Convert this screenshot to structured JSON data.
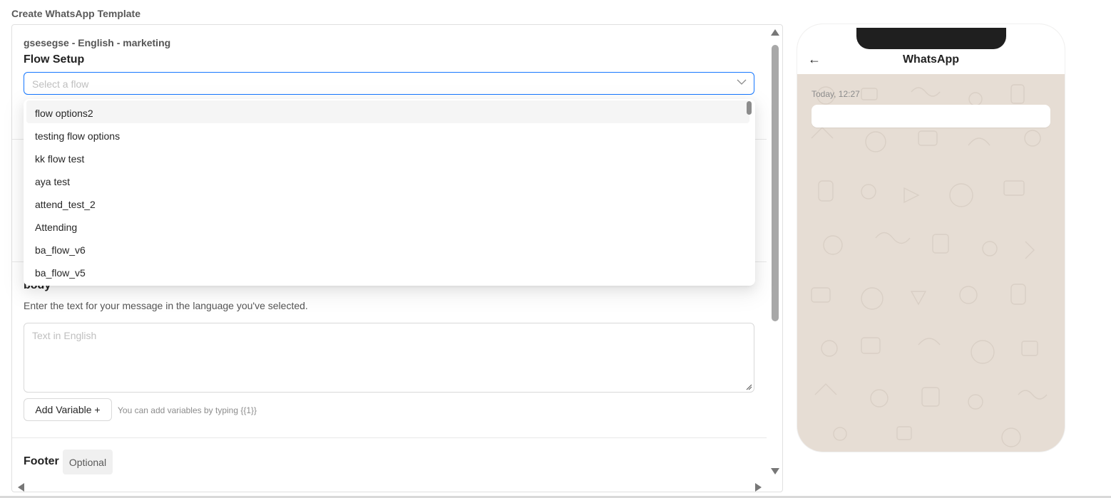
{
  "page": {
    "title": "Create WhatsApp Template"
  },
  "editor": {
    "subtitle": "gsesegse - English - marketing",
    "flow_setup": {
      "title": "Flow Setup",
      "select_placeholder": "Select a flow"
    },
    "dropdown": {
      "options": [
        "flow options2",
        "testing flow options",
        "kk flow test",
        "aya test",
        "attend_test_2",
        "Attending",
        "ba_flow_v6",
        "ba_flow_v5"
      ],
      "active_index": 0
    },
    "body": {
      "title": "body",
      "description": "Enter the text for your message in the language you've selected.",
      "text_placeholder": "Text in English",
      "add_variable_label": "Add Variable +",
      "hint": "You can add variables by typing {{1}}"
    },
    "footer": {
      "title": "Footer",
      "optional_tag": "Optional"
    }
  },
  "preview": {
    "app_title": "WhatsApp",
    "back_glyph": "←",
    "timestamp": "Today, 12:27",
    "back_icon": "arrow-left-icon",
    "chat_background_color": "#e6ddd4"
  },
  "colors": {
    "accent": "#1677ff",
    "border": "#d9d9d9"
  }
}
